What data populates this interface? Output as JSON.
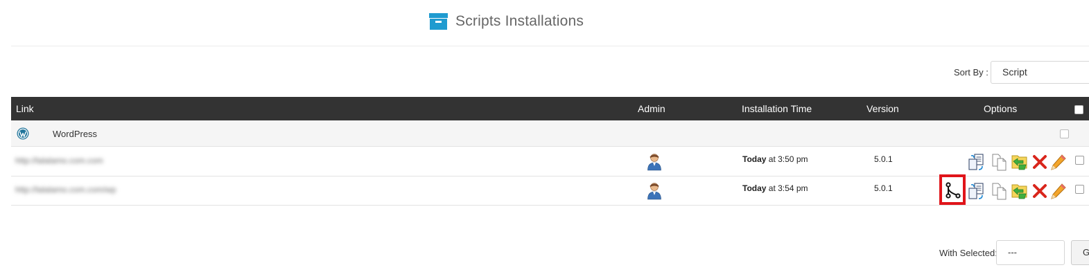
{
  "page": {
    "title": "Scripts Installations"
  },
  "sort": {
    "label": "Sort By :",
    "selected": "Script"
  },
  "table": {
    "headers": {
      "link": "Link",
      "admin": "Admin",
      "installation_time": "Installation Time",
      "version": "Version",
      "options": "Options"
    },
    "group": {
      "label": "WordPress"
    },
    "rows": [
      {
        "link": "http://lalalamo.com.com",
        "time_prefix": "Today",
        "time_suffix": " at 3:50 pm",
        "version": "5.0.1"
      },
      {
        "link": "http://lalalamo.com.com/wp",
        "time_prefix": "Today",
        "time_suffix": " at 3:54 pm",
        "version": "5.0.1"
      }
    ]
  },
  "footer": {
    "with_selected_label": "With Selected:",
    "with_selected_value": "---",
    "go_label": "G"
  },
  "colors": {
    "header_bg": "#333333",
    "accent_blue": "#1f9bd0",
    "delete_red": "#d9261c",
    "highlight_red": "#e0141a"
  },
  "icons": {
    "title": "archive-box-icon",
    "wordpress": "wordpress-icon",
    "admin": "admin-user-icon",
    "options": [
      "clone-icon",
      "backup-icon",
      "copy-icon",
      "restore-icon",
      "delete-icon",
      "edit-icon"
    ],
    "highlighted": "git-branch-icon"
  }
}
